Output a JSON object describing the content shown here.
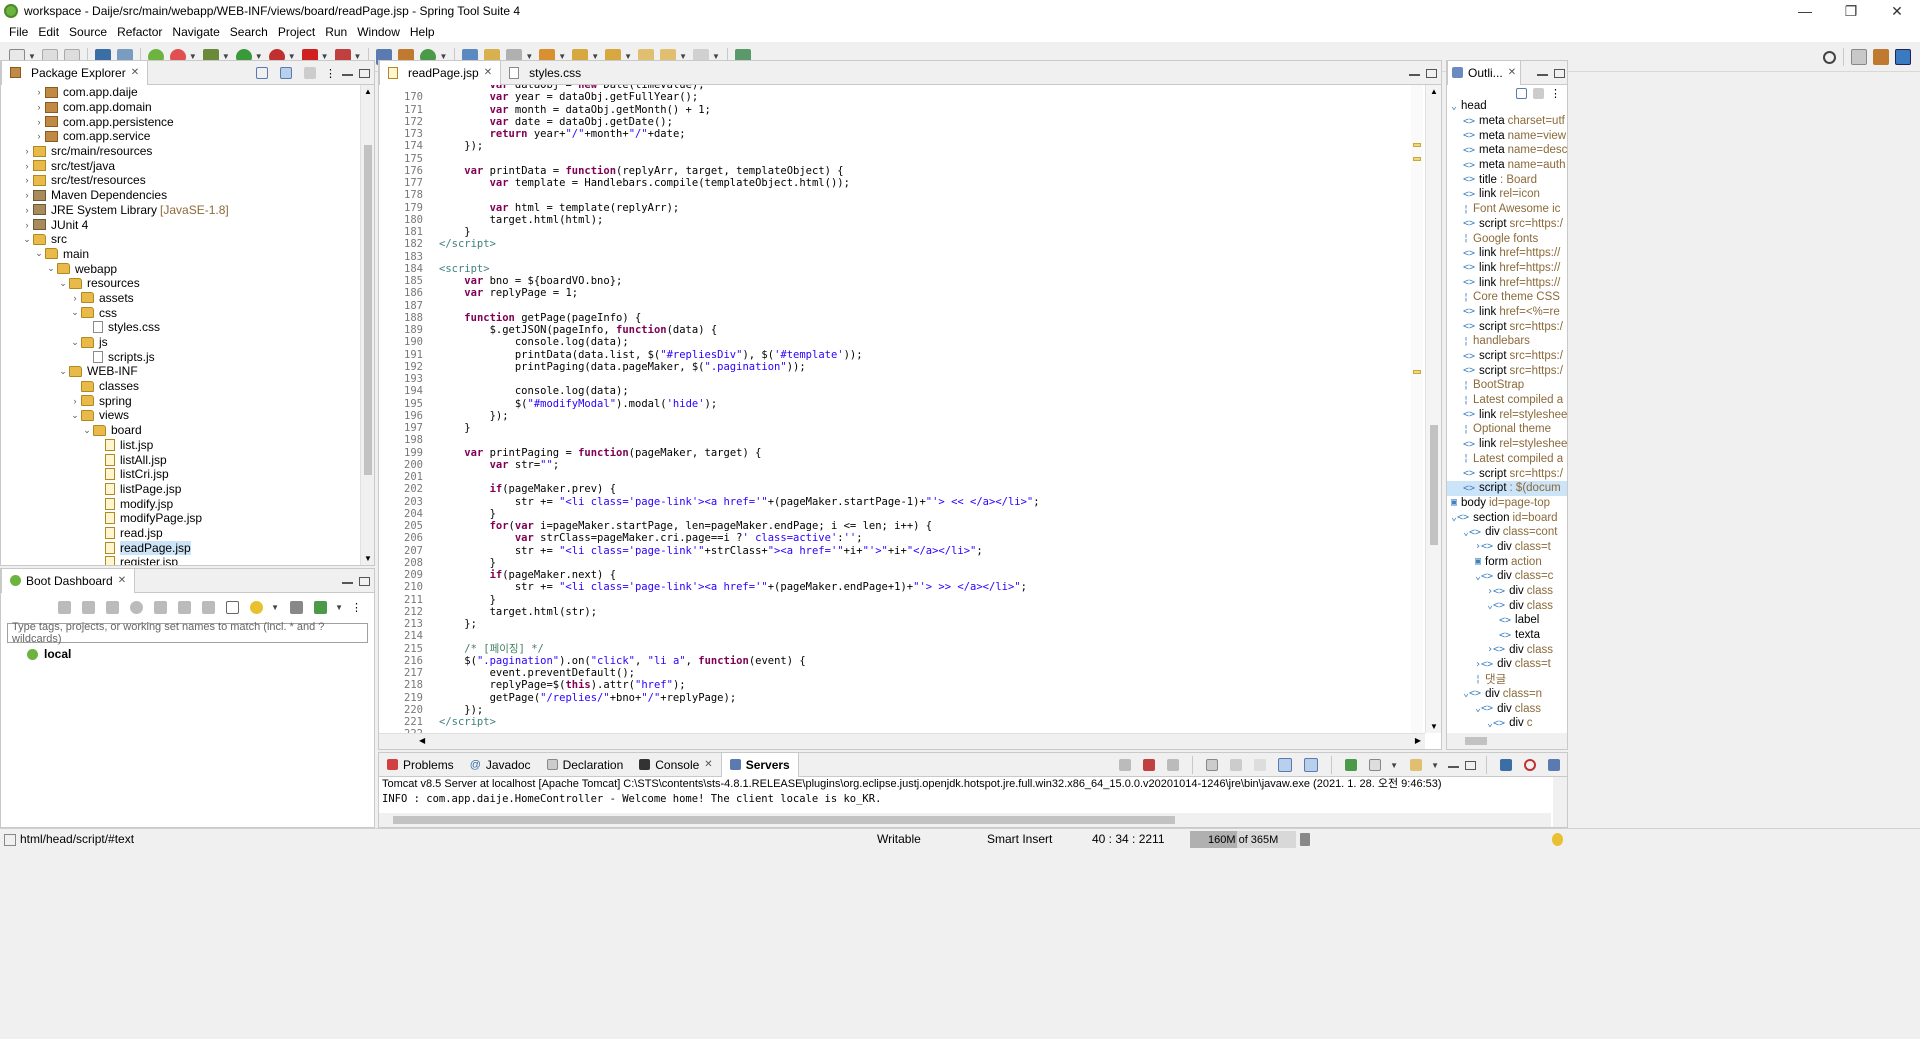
{
  "window": {
    "title": "workspace - Daije/src/main/webapp/WEB-INF/views/board/readPage.jsp - Spring Tool Suite 4",
    "minimize": "—",
    "maximize": "❐",
    "close": "✕"
  },
  "menu": [
    "File",
    "Edit",
    "Source",
    "Refactor",
    "Navigate",
    "Search",
    "Project",
    "Run",
    "Window",
    "Help"
  ],
  "package_explorer": {
    "tab_label": "Package Explorer",
    "rows": [
      {
        "indent": 2,
        "arrow": "›",
        "icon": "pkg",
        "label": "com.app.daije"
      },
      {
        "indent": 2,
        "arrow": "›",
        "icon": "pkg",
        "label": "com.app.domain"
      },
      {
        "indent": 2,
        "arrow": "›",
        "icon": "pkg",
        "label": "com.app.persistence"
      },
      {
        "indent": 2,
        "arrow": "›",
        "icon": "pkg",
        "label": "com.app.service"
      },
      {
        "indent": 1,
        "arrow": "›",
        "icon": "src",
        "label": "src/main/resources"
      },
      {
        "indent": 1,
        "arrow": "›",
        "icon": "src",
        "label": "src/test/java"
      },
      {
        "indent": 1,
        "arrow": "›",
        "icon": "src",
        "label": "src/test/resources"
      },
      {
        "indent": 1,
        "arrow": "›",
        "icon": "lib",
        "label": "Maven Dependencies"
      },
      {
        "indent": 1,
        "arrow": "›",
        "icon": "lib",
        "label": "JRE System Library",
        "dec": "[JavaSE-1.8]"
      },
      {
        "indent": 1,
        "arrow": "›",
        "icon": "lib",
        "label": "JUnit 4"
      },
      {
        "indent": 1,
        "arrow": "⌄",
        "icon": "folder",
        "label": "src"
      },
      {
        "indent": 2,
        "arrow": "⌄",
        "icon": "folder",
        "label": "main"
      },
      {
        "indent": 3,
        "arrow": "⌄",
        "icon": "folder",
        "label": "webapp"
      },
      {
        "indent": 4,
        "arrow": "⌄",
        "icon": "folder",
        "label": "resources"
      },
      {
        "indent": 5,
        "arrow": "›",
        "icon": "folder",
        "label": "assets"
      },
      {
        "indent": 5,
        "arrow": "⌄",
        "icon": "folder",
        "label": "css"
      },
      {
        "indent": 6,
        "arrow": "",
        "icon": "file",
        "label": "styles.css"
      },
      {
        "indent": 5,
        "arrow": "⌄",
        "icon": "folder",
        "label": "js"
      },
      {
        "indent": 6,
        "arrow": "",
        "icon": "file",
        "label": "scripts.js"
      },
      {
        "indent": 4,
        "arrow": "⌄",
        "icon": "folder",
        "label": "WEB-INF"
      },
      {
        "indent": 5,
        "arrow": "",
        "icon": "folder",
        "label": "classes"
      },
      {
        "indent": 5,
        "arrow": "›",
        "icon": "folder",
        "label": "spring"
      },
      {
        "indent": 5,
        "arrow": "⌄",
        "icon": "folder",
        "label": "views"
      },
      {
        "indent": 6,
        "arrow": "⌄",
        "icon": "folder",
        "label": "board"
      },
      {
        "indent": 7,
        "arrow": "",
        "icon": "jsp",
        "label": "list.jsp"
      },
      {
        "indent": 7,
        "arrow": "",
        "icon": "jsp",
        "label": "listAll.jsp"
      },
      {
        "indent": 7,
        "arrow": "",
        "icon": "jsp",
        "label": "listCri.jsp"
      },
      {
        "indent": 7,
        "arrow": "",
        "icon": "jsp",
        "label": "listPage.jsp"
      },
      {
        "indent": 7,
        "arrow": "",
        "icon": "jsp",
        "label": "modify.jsp"
      },
      {
        "indent": 7,
        "arrow": "",
        "icon": "jsp",
        "label": "modifyPage.jsp"
      },
      {
        "indent": 7,
        "arrow": "",
        "icon": "jsp",
        "label": "read.jsp"
      },
      {
        "indent": 7,
        "arrow": "",
        "icon": "jsp",
        "label": "readPage.jsp",
        "selected": true
      },
      {
        "indent": 7,
        "arrow": "",
        "icon": "jsp",
        "label": "register.jsp"
      }
    ]
  },
  "boot_dashboard": {
    "tab_label": "Boot Dashboard",
    "filter_placeholder": "Type tags, projects, or working set names to match (incl. * and ? wildcards)",
    "local_label": "local"
  },
  "editor": {
    "tabs": [
      {
        "label": "readPage.jsp",
        "active": true
      },
      {
        "label": "styles.css",
        "active": false
      }
    ],
    "lines": [
      {
        "n": "",
        "h": "        <k>var</k> dataObj = <k>new</k> Date(timeValue);"
      },
      {
        "n": "170",
        "h": "        <k>var</k> year = dataObj.getFullYear();"
      },
      {
        "n": "171",
        "h": "        <k>var</k> month = dataObj.getMonth() + 1;"
      },
      {
        "n": "172",
        "h": "        <k>var</k> date = dataObj.getDate();"
      },
      {
        "n": "173",
        "h": "        <k>return</k> year+<s>\"/\"</s>+month+<s>\"/\"</s>+date;"
      },
      {
        "n": "174",
        "h": "    });"
      },
      {
        "n": "175",
        "h": ""
      },
      {
        "n": "176",
        "h": "    <k>var</k> printData = <k>function</k>(replyArr, target, templateObject) {"
      },
      {
        "n": "177",
        "h": "        <k>var</k> template = Handlebars.compile(templateObject.html());"
      },
      {
        "n": "178",
        "h": ""
      },
      {
        "n": "179",
        "h": "        <k>var</k> html = template(replyArr);"
      },
      {
        "n": "180",
        "h": "        target.html(html);"
      },
      {
        "n": "181",
        "h": "    }"
      },
      {
        "n": "182",
        "h": "<t>&lt;/script&gt;</t>"
      },
      {
        "n": "183",
        "h": ""
      },
      {
        "n": "184",
        "h": "<t>&lt;script&gt;</t>"
      },
      {
        "n": "185",
        "h": "    <k>var</k> bno = ${boardVO.bno};"
      },
      {
        "n": "186",
        "h": "    <k>var</k> replyPage = 1;"
      },
      {
        "n": "187",
        "h": ""
      },
      {
        "n": "188",
        "h": "    <k>function</k> getPage(pageInfo) {"
      },
      {
        "n": "189",
        "h": "        $.getJSON(pageInfo, <k>function</k>(data) {"
      },
      {
        "n": "190",
        "h": "            console.log(data);"
      },
      {
        "n": "191",
        "h": "            printData(data.list, $(<s>\"#repliesDiv\"</s>), $(<s>'#template'</s>));"
      },
      {
        "n": "192",
        "h": "            printPaging(data.pageMaker, $(<s>\".pagination\"</s>));"
      },
      {
        "n": "193",
        "h": ""
      },
      {
        "n": "194",
        "h": "            console.log(data);"
      },
      {
        "n": "195",
        "h": "            $(<s>\"#modifyModal\"</s>).modal(<s>'hide'</s>);"
      },
      {
        "n": "196",
        "h": "        });"
      },
      {
        "n": "197",
        "h": "    }"
      },
      {
        "n": "198",
        "h": ""
      },
      {
        "n": "199",
        "h": "    <k>var</k> printPaging = <k>function</k>(pageMaker, target) {"
      },
      {
        "n": "200",
        "h": "        <k>var</k> str=<s>\"\"</s>;"
      },
      {
        "n": "201",
        "h": ""
      },
      {
        "n": "202",
        "h": "        <k>if</k>(pageMaker.prev) {"
      },
      {
        "n": "203",
        "h": "            str += <s>\"&lt;li class='page-link'&gt;&lt;a href='\"</s>+(pageMaker.startPage-1)+<s>\"'&gt; &lt;&lt; &lt;/a&gt;&lt;/li&gt;\"</s>;"
      },
      {
        "n": "204",
        "h": "        }"
      },
      {
        "n": "205",
        "h": "        <k>for</k>(<k>var</k> i=pageMaker.startPage, len=pageMaker.endPage; i &lt;= len; i++) {"
      },
      {
        "n": "206",
        "h": "            <k>var</k> strClass=pageMaker.cri.page==i ?<s>' class=active'</s>:<s>''</s>;"
      },
      {
        "n": "207",
        "h": "            str += <s>\"&lt;li class='page-link'\"</s>+strClass+<s>\"&gt;&lt;a href='\"</s>+i+<s>\"'&gt;\"</s>+i+<s>\"&lt;/a&gt;&lt;/li&gt;\"</s>;"
      },
      {
        "n": "208",
        "h": "        }"
      },
      {
        "n": "209",
        "h": "        <k>if</k>(pageMaker.next) {"
      },
      {
        "n": "210",
        "h": "            str += <s>\"&lt;li class='page-link'&gt;&lt;a href='\"</s>+(pageMaker.endPage+1)+<s>\"'&gt; &gt;&gt; &lt;/a&gt;&lt;/li&gt;\"</s>;"
      },
      {
        "n": "211",
        "h": "        }"
      },
      {
        "n": "212",
        "h": "        target.html(str);"
      },
      {
        "n": "213",
        "h": "    };"
      },
      {
        "n": "214",
        "h": ""
      },
      {
        "n": "215",
        "h": "    <c>/* [페이징] */</c>"
      },
      {
        "n": "216",
        "h": "    $(<s>\".pagination\"</s>).on(<s>\"click\"</s>, <s>\"li a\"</s>, <k>function</k>(event) {"
      },
      {
        "n": "217",
        "h": "        event.preventDefault();"
      },
      {
        "n": "218",
        "h": "        replyPage=$(<k>this</k>).attr(<s>\"href\"</s>);"
      },
      {
        "n": "219",
        "h": "        getPage(<s>\"/replies/\"</s>+bno+<s>\"/\"</s>+replyPage);"
      },
      {
        "n": "220",
        "h": "    });"
      },
      {
        "n": "221",
        "h": "<t>&lt;/script&gt;</t>"
      },
      {
        "n": "222",
        "h": ""
      }
    ]
  },
  "outline": {
    "tab_label": "Outli...",
    "rows": [
      {
        "indent": 0,
        "i": "⌄",
        "t": "head",
        "a": ""
      },
      {
        "indent": 1,
        "i": "<>",
        "t": "meta",
        "a": "charset=utf"
      },
      {
        "indent": 1,
        "i": "<>",
        "t": "meta",
        "a": "name=view"
      },
      {
        "indent": 1,
        "i": "<>",
        "t": "meta",
        "a": "name=desc"
      },
      {
        "indent": 1,
        "i": "<>",
        "t": "meta",
        "a": "name=auth"
      },
      {
        "indent": 1,
        "i": "<>",
        "t": "title",
        "a": ": Board"
      },
      {
        "indent": 1,
        "i": "<>",
        "t": "link",
        "a": "rel=icon"
      },
      {
        "indent": 1,
        "i": "¦",
        "t": "",
        "a": "Font Awesome ic"
      },
      {
        "indent": 1,
        "i": "<>",
        "t": "script",
        "a": "src=https:/"
      },
      {
        "indent": 1,
        "i": "¦",
        "t": "",
        "a": "Google fonts"
      },
      {
        "indent": 1,
        "i": "<>",
        "t": "link",
        "a": "href=https://"
      },
      {
        "indent": 1,
        "i": "<>",
        "t": "link",
        "a": "href=https://"
      },
      {
        "indent": 1,
        "i": "<>",
        "t": "link",
        "a": "href=https://"
      },
      {
        "indent": 1,
        "i": "¦",
        "t": "",
        "a": "Core theme CSS"
      },
      {
        "indent": 1,
        "i": "<>",
        "t": "link",
        "a": "href=<%=re"
      },
      {
        "indent": 1,
        "i": "<>",
        "t": "script",
        "a": "src=https:/"
      },
      {
        "indent": 1,
        "i": "¦",
        "t": "",
        "a": "handlebars"
      },
      {
        "indent": 1,
        "i": "<>",
        "t": "script",
        "a": "src=https:/"
      },
      {
        "indent": 1,
        "i": "<>",
        "t": "script",
        "a": "src=https:/"
      },
      {
        "indent": 1,
        "i": "¦",
        "t": "",
        "a": "BootStrap"
      },
      {
        "indent": 1,
        "i": "¦",
        "t": "",
        "a": "Latest compiled a"
      },
      {
        "indent": 1,
        "i": "<>",
        "t": "link",
        "a": "rel=styleshee"
      },
      {
        "indent": 1,
        "i": "¦",
        "t": "",
        "a": "Optional theme"
      },
      {
        "indent": 1,
        "i": "<>",
        "t": "link",
        "a": "rel=styleshee"
      },
      {
        "indent": 1,
        "i": "¦",
        "t": "",
        "a": "Latest compiled a"
      },
      {
        "indent": 1,
        "i": "<>",
        "t": "script",
        "a": "src=https:/"
      },
      {
        "indent": 1,
        "i": "<>",
        "t": "script",
        "a": ": $(docum",
        "sel": true
      },
      {
        "indent": 0,
        "i": "▣",
        "t": "body",
        "a": "id=page-top"
      },
      {
        "indent": 0,
        "i": "⌄<>",
        "t": "section",
        "a": "id=board"
      },
      {
        "indent": 1,
        "i": "⌄<>",
        "t": "div",
        "a": "class=cont"
      },
      {
        "indent": 2,
        "i": "›<>",
        "t": "div",
        "a": "class=t"
      },
      {
        "indent": 2,
        "i": "▣",
        "t": "form",
        "a": "action"
      },
      {
        "indent": 2,
        "i": "⌄<>",
        "t": "div",
        "a": "class=c"
      },
      {
        "indent": 3,
        "i": "›<>",
        "t": "div",
        "a": "class"
      },
      {
        "indent": 3,
        "i": "⌄<>",
        "t": "div",
        "a": "class"
      },
      {
        "indent": 4,
        "i": "<>",
        "t": "label",
        "a": ""
      },
      {
        "indent": 4,
        "i": "<>",
        "t": "texta",
        "a": ""
      },
      {
        "indent": 3,
        "i": "›<>",
        "t": "div",
        "a": "class"
      },
      {
        "indent": 2,
        "i": "›<>",
        "t": "div",
        "a": "class=t"
      },
      {
        "indent": 2,
        "i": "¦",
        "t": "",
        "a": "댓글"
      },
      {
        "indent": 1,
        "i": "⌄<>",
        "t": "div",
        "a": "class=n"
      },
      {
        "indent": 2,
        "i": "⌄<>",
        "t": "div",
        "a": "class"
      },
      {
        "indent": 3,
        "i": "⌄<>",
        "t": "div",
        "a": "c"
      }
    ]
  },
  "bottom": {
    "tabs": [
      {
        "label": "Problems",
        "active": false
      },
      {
        "label": "Javadoc",
        "active": false
      },
      {
        "label": "Declaration",
        "active": false
      },
      {
        "label": "Console",
        "active": false
      },
      {
        "label": "Servers",
        "active": true
      }
    ],
    "console_desc": "Tomcat v8.5 Server at localhost [Apache Tomcat] C:\\STS\\contents\\sts-4.8.1.RELEASE\\plugins\\org.eclipse.justj.openjdk.hotspot.jre.full.win32.x86_64_15.0.0.v20201014-1246\\jre\\bin\\javaw.exe  (2021. 1. 28. 오전 9:46:53)",
    "console_line": "INFO : com.app.daije.HomeController - Welcome home! The client locale is ko_KR."
  },
  "status": {
    "path": "html/head/script/#text",
    "writable": "Writable",
    "insert_mode": "Smart Insert",
    "position": "40 : 34 : 2211",
    "memory": "160M of 365M",
    "memory_used_fraction": 0.44
  },
  "colors": {
    "keyword": "#7f0055",
    "string": "#2a00ff",
    "tag": "#3f7f7f",
    "comment": "#3f7f5f",
    "selection": "#cce4f7",
    "spring_green": "#6db33f"
  }
}
